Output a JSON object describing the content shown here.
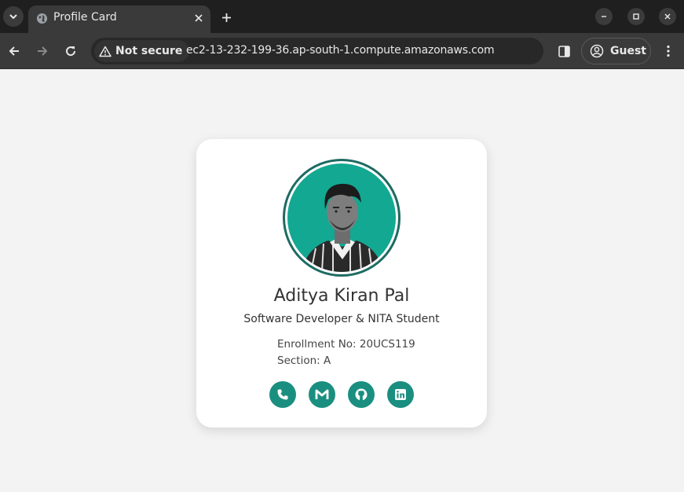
{
  "browser": {
    "tab_title": "Profile Card",
    "security_label": "Not secure",
    "url": "ec2-13-232-199-36.ap-south-1.compute.amazonaws.com",
    "profile_label": "Guest"
  },
  "profile": {
    "name": "Aditya Kiran Pal",
    "role": "Software Developer & NITA Student",
    "enrollment": "Enrollment No: 20UCS119",
    "section": "Section: A"
  },
  "social_icons": [
    "phone-icon",
    "gmail-icon",
    "github-icon",
    "linkedin-icon"
  ],
  "colors": {
    "accent": "#1a8f80",
    "avatar_bg": "#13a892",
    "avatar_ring": "#1d6b63",
    "card_bg": "#ffffff",
    "page_bg": "#f3f3f3"
  }
}
